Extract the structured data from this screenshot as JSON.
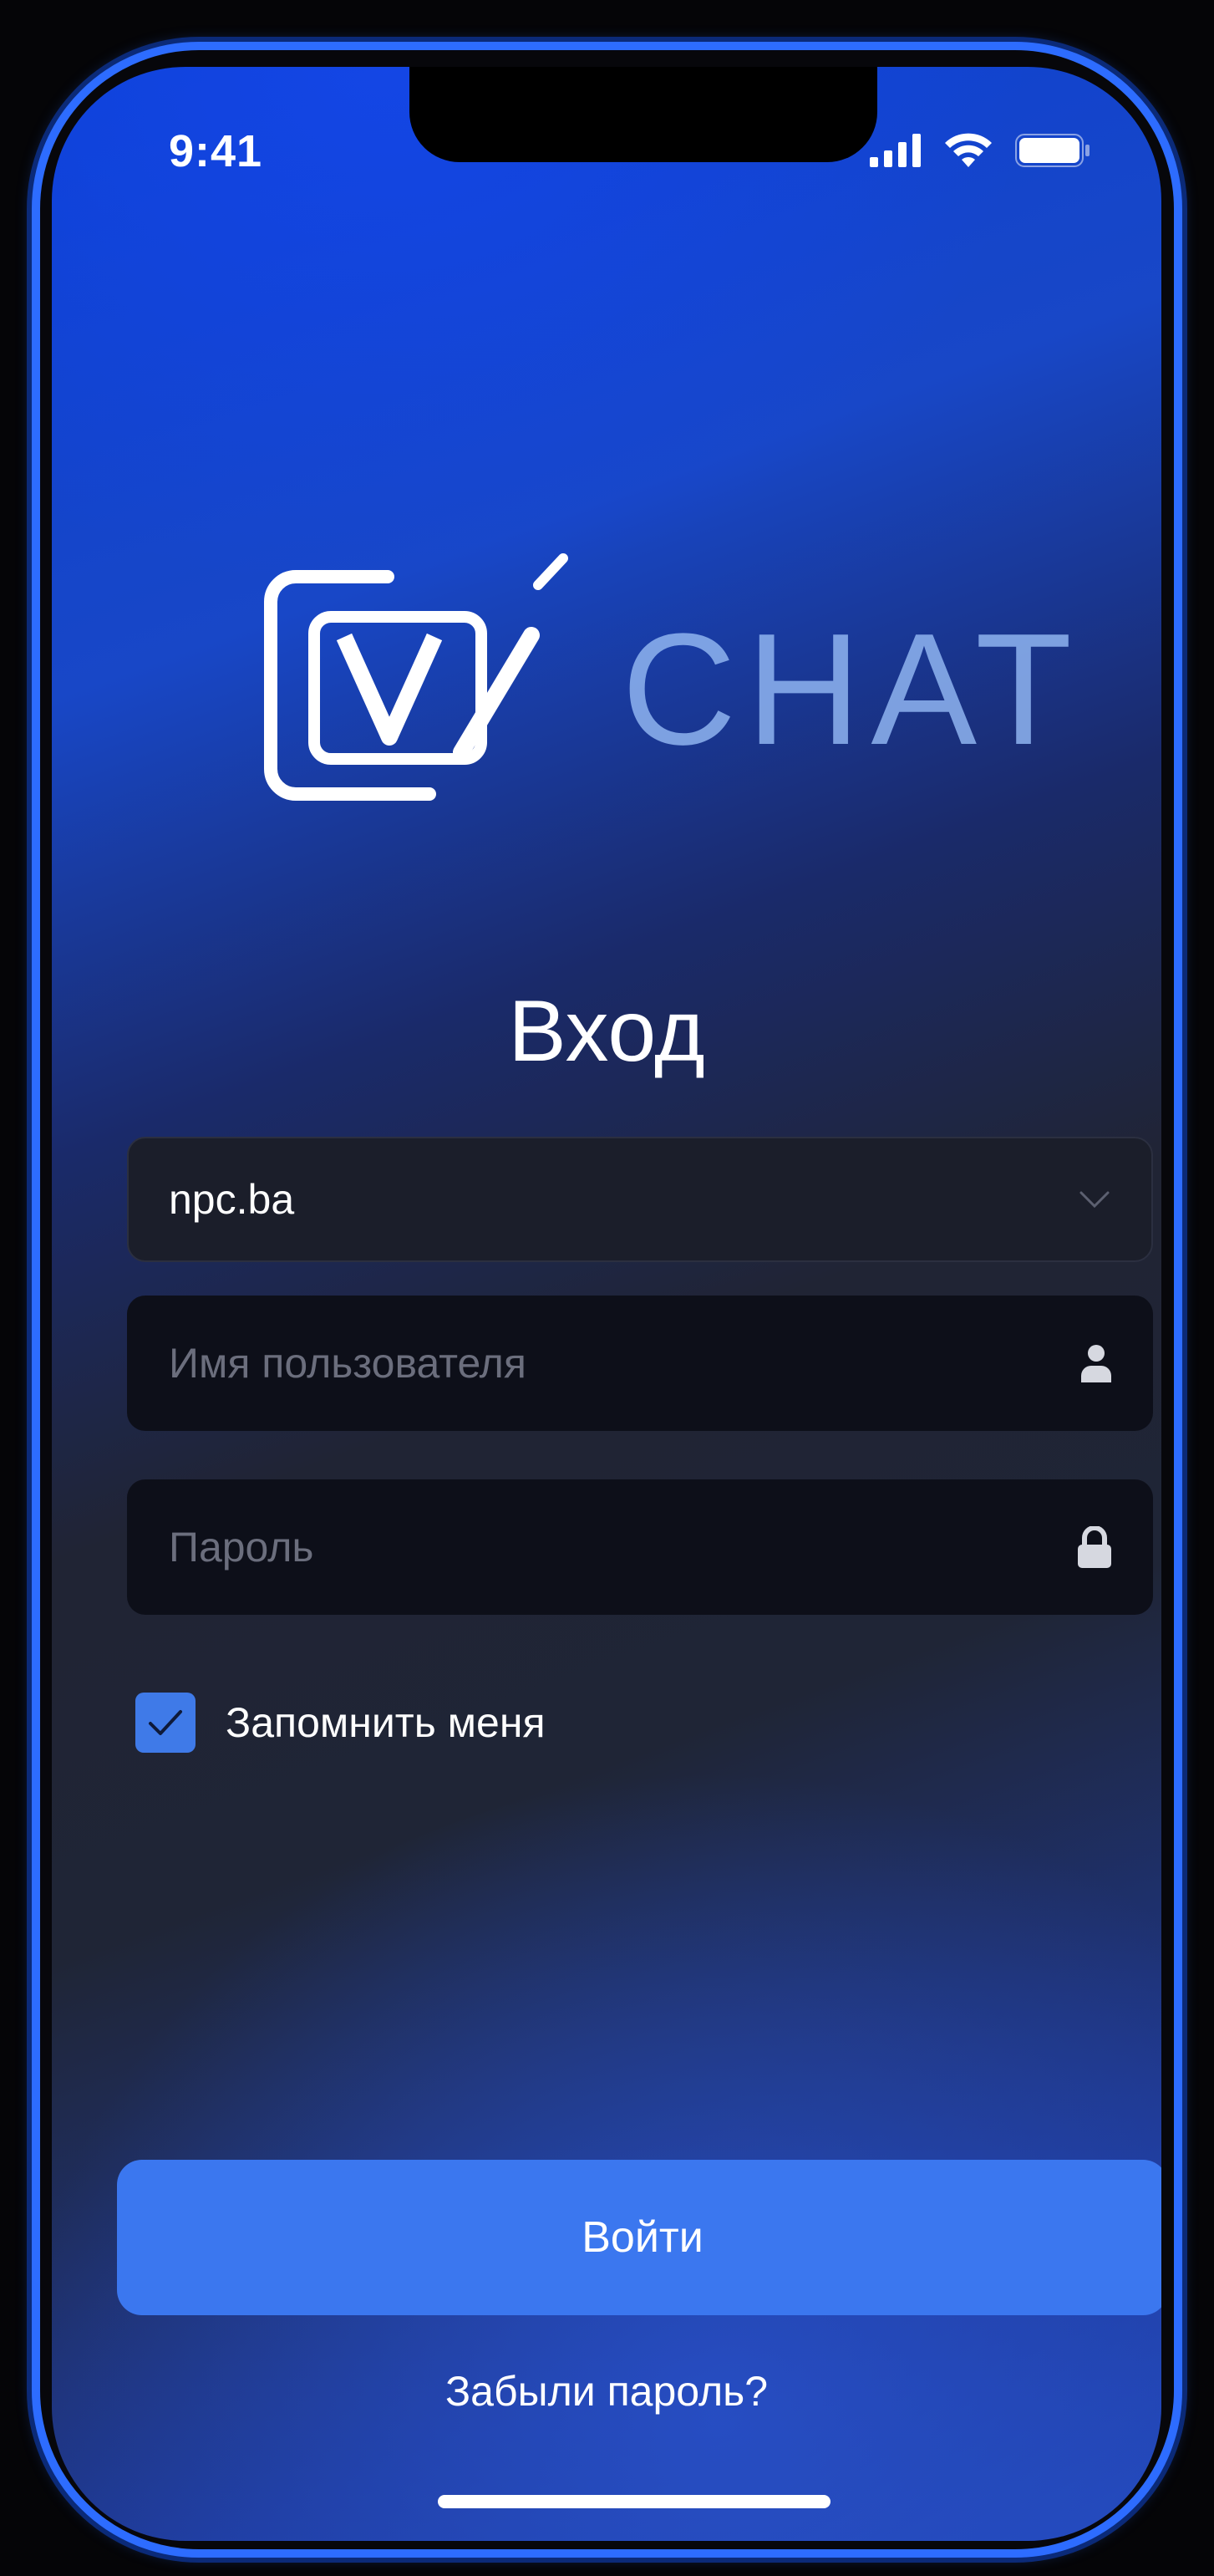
{
  "status_bar": {
    "time": "9:41",
    "signal_icon": "cellular-signal-icon",
    "wifi_icon": "wifi-icon",
    "battery_icon": "battery-icon"
  },
  "brand": {
    "logo_text": "CHAT",
    "accent": "#2d6cff"
  },
  "login": {
    "title": "Вход",
    "domain_value": "npc.ba",
    "domain_icon": "chevron-down-icon",
    "username_placeholder": "Имя пользователя",
    "username_icon": "user-icon",
    "password_placeholder": "Пароль",
    "password_icon": "lock-icon",
    "remember_label": "Запомнить меня",
    "remember_checked": true,
    "submit_label": "Войти",
    "forgot_label": "Забыли пароль?",
    "button_color": "#3b77ef"
  }
}
